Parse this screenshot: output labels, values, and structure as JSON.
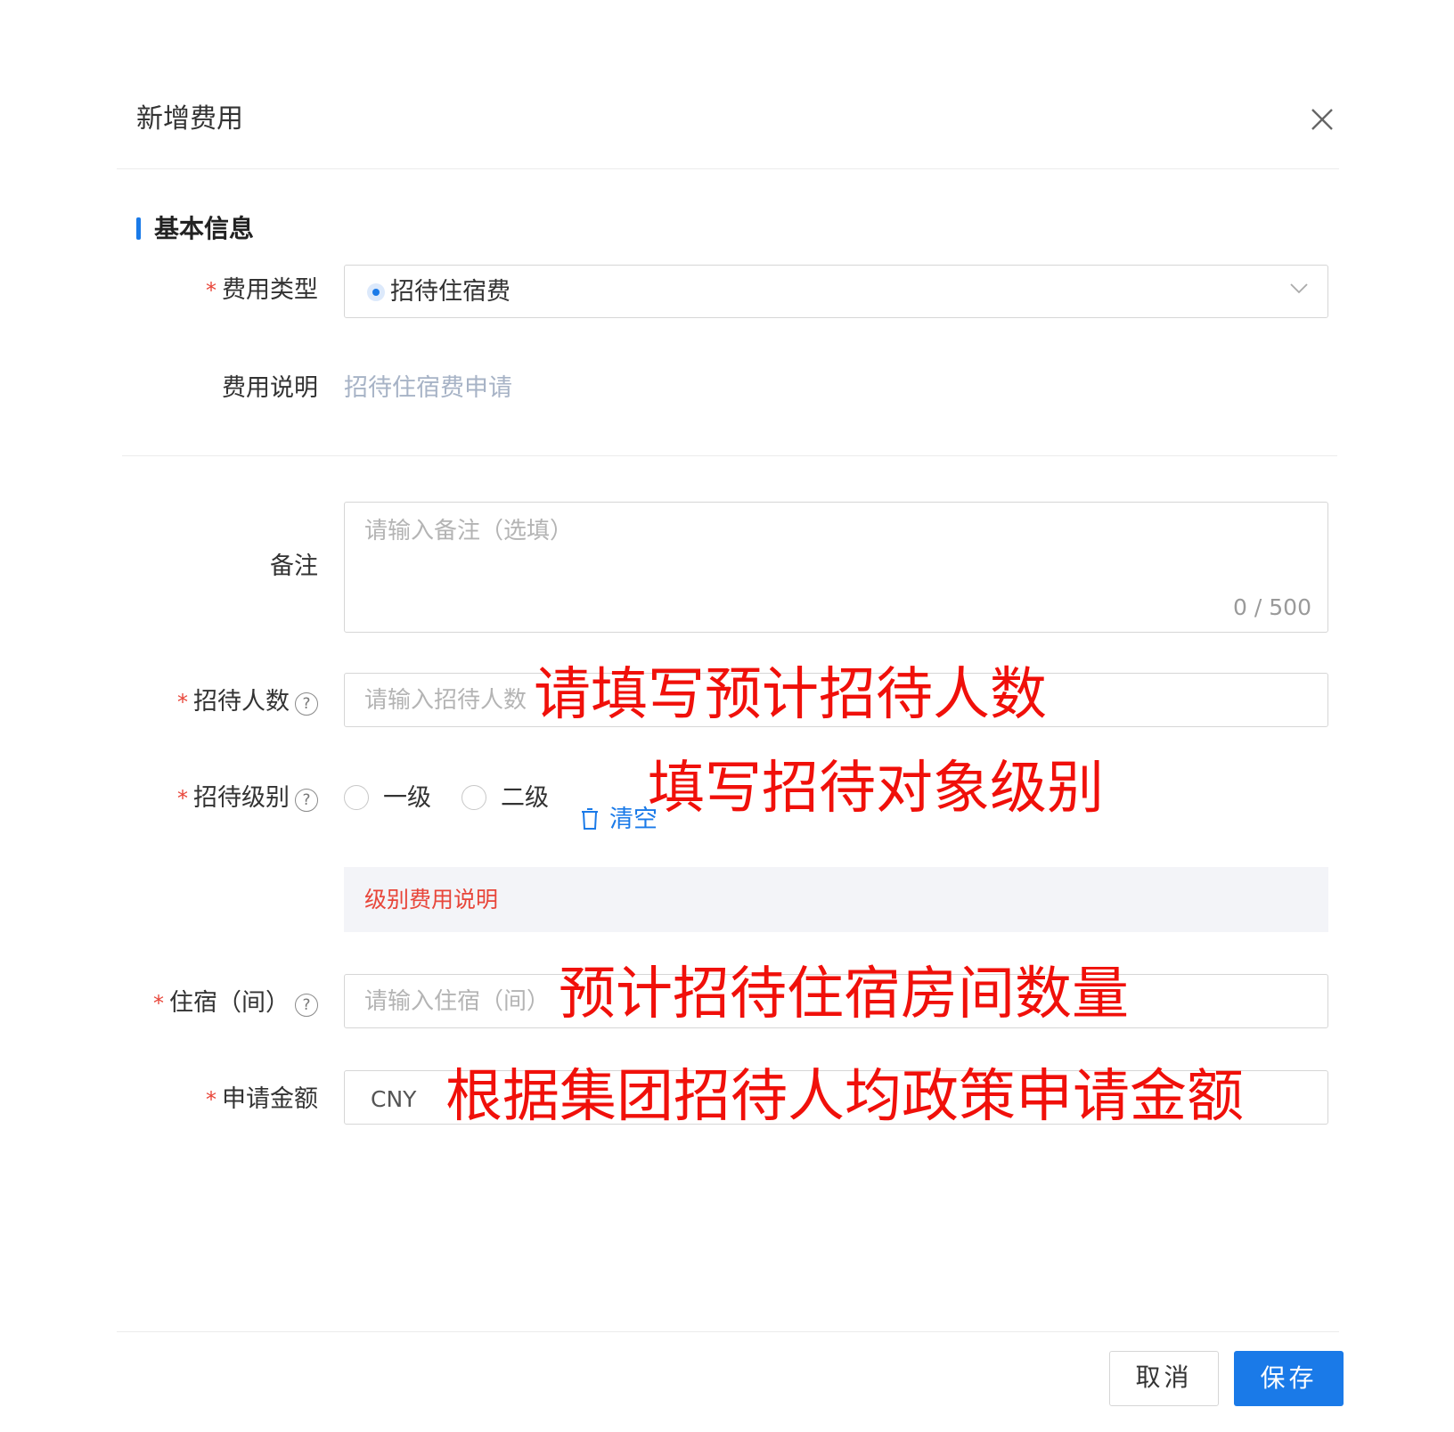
{
  "dialog": {
    "title": "新增费用"
  },
  "section": {
    "title": "基本信息"
  },
  "form": {
    "required_mark": "*",
    "help_mark": "?",
    "expense_type": {
      "label": "费用类型",
      "value": "招待住宿费"
    },
    "expense_desc": {
      "label": "费用说明",
      "value": "招待住宿费申请"
    },
    "remark": {
      "label": "备注",
      "placeholder": "请输入备注（选填）",
      "counter": "0 / 500"
    },
    "guest_count": {
      "label": "招待人数",
      "placeholder": "请输入招待人数"
    },
    "guest_level": {
      "label": "招待级别",
      "options": [
        "一级",
        "二级"
      ],
      "clear_label": "清空",
      "hint": "级别费用说明"
    },
    "rooms": {
      "label": "住宿（间）",
      "placeholder": "请输入住宿（间）"
    },
    "amount": {
      "label": "申请金额",
      "currency": "CNY"
    }
  },
  "annotations": {
    "guest_count": "请填写预计招待人数",
    "guest_level": "填写招待对象级别",
    "rooms": "预计招待住宿房间数量",
    "amount": "根据集团招待人均政策申请金额"
  },
  "footer": {
    "cancel_label": "取消",
    "save_label": "保存"
  },
  "colors": {
    "primary": "#1a7ae8",
    "required": "#e8463a",
    "annotation": "#f0100a"
  }
}
